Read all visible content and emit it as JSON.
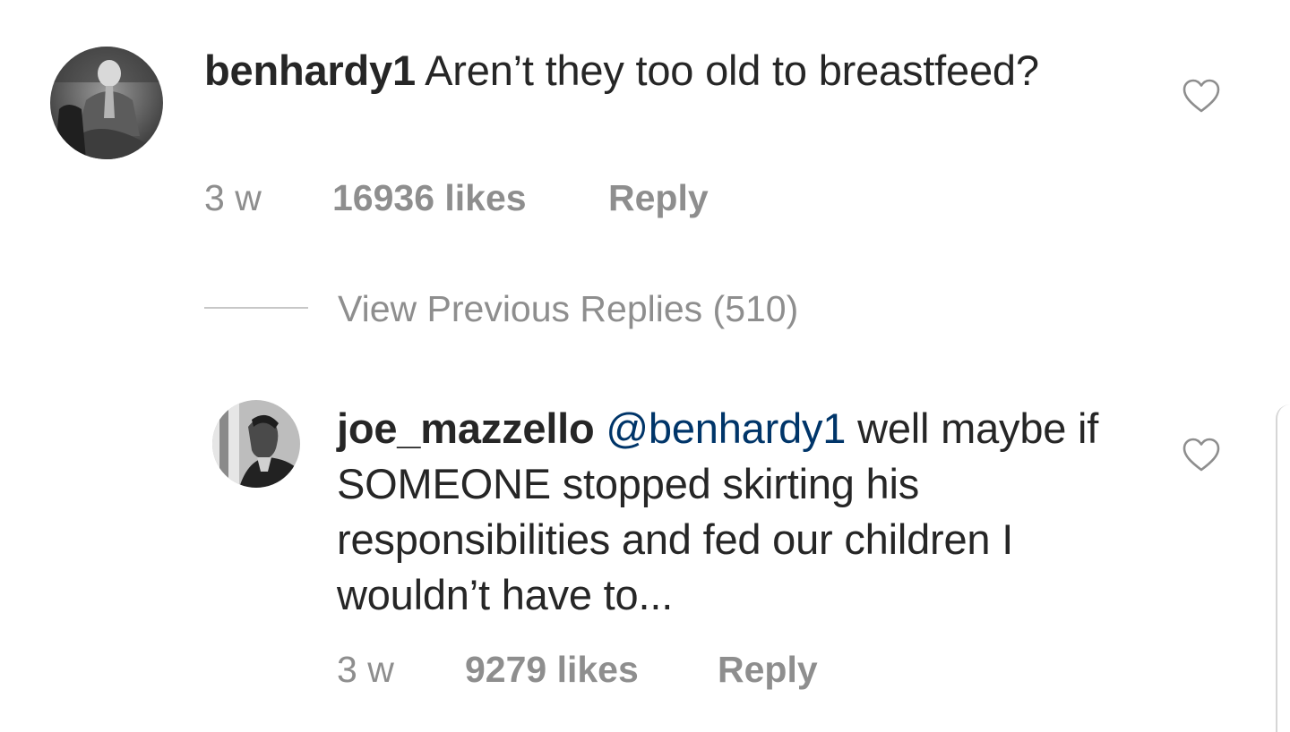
{
  "comment": {
    "username": "benhardy1",
    "text": "Aren’t they too old to breastfeed?",
    "time": "3 w",
    "likes": "16936 likes",
    "reply_label": "Reply",
    "avatar_icon": "profile-photo-icon",
    "like_icon": "heart-outline-icon"
  },
  "view_replies": {
    "label": "View Previous Replies (510)"
  },
  "reply": {
    "username": "joe_mazzello",
    "mention": "@benhardy1",
    "text": "well maybe if SOMEONE stopped skirting his responsibilities and fed our children I wouldn’t have to...",
    "time": "3 w",
    "likes": "9279 likes",
    "reply_label": "Reply",
    "avatar_icon": "profile-photo-icon",
    "like_icon": "heart-outline-icon"
  },
  "colors": {
    "text": "#262626",
    "muted": "#8e8e8e",
    "mention": "#003569",
    "divider": "#c7c7c7"
  }
}
